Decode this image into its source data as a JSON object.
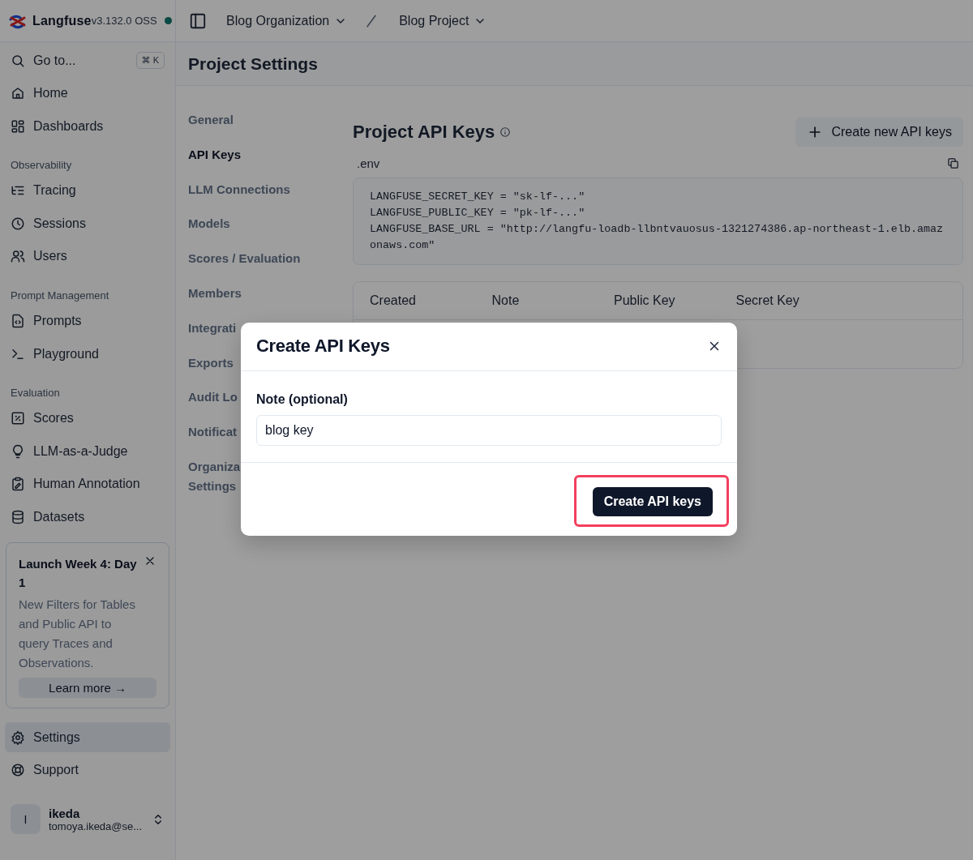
{
  "topbar": {
    "logo": "Langfuse",
    "version": "v3.132.0 OSS",
    "breadcrumbs": [
      {
        "label": "Blog Organization"
      },
      {
        "label": "Blog Project"
      }
    ]
  },
  "sidebar": {
    "search": {
      "label": "Go to...",
      "shortcut": "⌘ K"
    },
    "groups": [
      {
        "items": [
          {
            "label": "Home",
            "selected": false
          },
          {
            "label": "Dashboards",
            "selected": false
          }
        ]
      },
      {
        "title": "Observability",
        "items": [
          {
            "label": "Tracing",
            "selected": false
          },
          {
            "label": "Sessions",
            "selected": false
          },
          {
            "label": "Users",
            "selected": false
          }
        ]
      },
      {
        "title": "Prompt Management",
        "items": [
          {
            "label": "Prompts",
            "selected": false
          },
          {
            "label": "Playground",
            "selected": false
          }
        ]
      },
      {
        "title": "Evaluation",
        "items": [
          {
            "label": "Scores",
            "selected": false
          },
          {
            "label": "LLM-as-a-Judge",
            "selected": false
          },
          {
            "label": "Human Annotation",
            "selected": false
          },
          {
            "label": "Datasets",
            "selected": false
          }
        ]
      }
    ],
    "announcement": {
      "title": "Launch Week 4: Day 1",
      "body": "New Filters for Tables and Public API to query Traces and Observations.",
      "link": "Learn more →"
    },
    "footer_items": [
      {
        "label": "Settings",
        "selected": true
      },
      {
        "label": "Support",
        "selected": false
      }
    ],
    "user": {
      "initial": "I",
      "name": "ikeda",
      "email": "tomoya.ikeda@se..."
    }
  },
  "page": {
    "title": "Project Settings",
    "nav": [
      {
        "label": "General",
        "selected": false
      },
      {
        "label": "API Keys",
        "selected": true
      },
      {
        "label": "LLM Connections",
        "selected": false
      },
      {
        "label": "Models",
        "selected": false
      },
      {
        "label": "Scores / Evaluation",
        "selected": false
      },
      {
        "label": "Members",
        "selected": false
      },
      {
        "label": "Integrati",
        "selected": false
      },
      {
        "label": "Exports",
        "selected": false
      },
      {
        "label": "Audit Lo",
        "selected": false
      },
      {
        "label": "Notificat",
        "selected": false
      },
      {
        "label": "Organiza\nSettings",
        "selected": false
      }
    ],
    "section": {
      "title": "Project API Keys",
      "create_button": "Create new API keys",
      "env_label": ".env",
      "env_code": "LANGFUSE_SECRET_KEY = \"sk-lf-...\"\nLANGFUSE_PUBLIC_KEY = \"pk-lf-...\"\nLANGFUSE_BASE_URL = \"http://langfu-loadb-llbntvauosus-1321274386.ap-northeast-1.elb.amazonaws.com\"",
      "table": {
        "columns": [
          "Created",
          "Note",
          "Public Key",
          "Secret Key"
        ]
      }
    }
  },
  "dialog": {
    "title": "Create API Keys",
    "field": {
      "label": "Note (optional)",
      "value": "blog key"
    },
    "submit": "Create API keys",
    "highlighted": true
  }
}
